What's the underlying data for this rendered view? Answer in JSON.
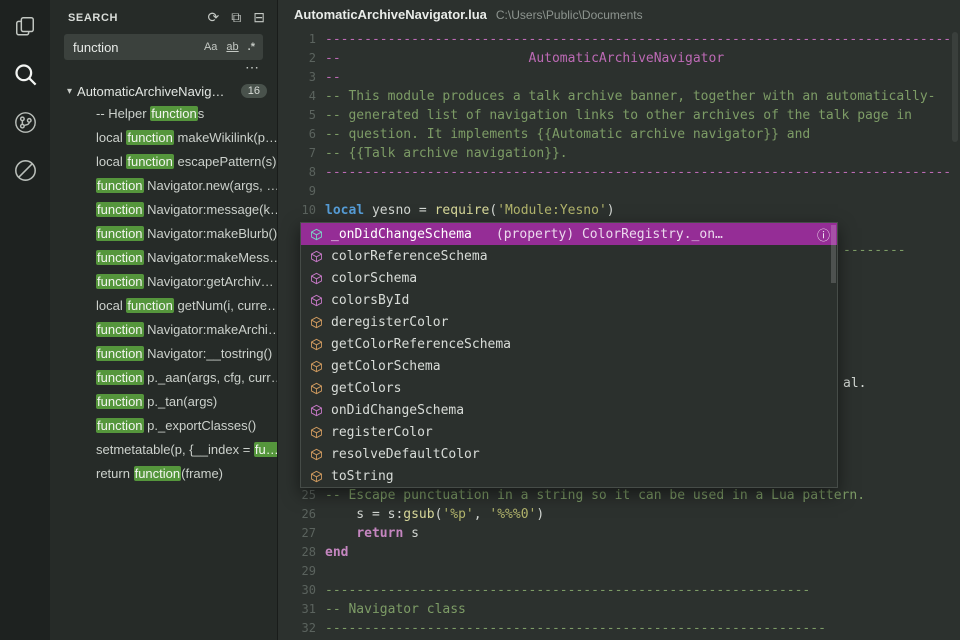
{
  "colors": {
    "match_green": "#55963c",
    "suggest_selected": "#952d96",
    "comment_green": "#7d9c66",
    "comment_pink": "#bd6ab5"
  },
  "activity_bar": {
    "items": [
      "files-icon",
      "search-icon",
      "source-control-icon",
      "blocked-icon"
    ]
  },
  "search_panel": {
    "title": "SEARCH",
    "actions": {
      "refresh": "⟳",
      "open_in_editor": "⧉",
      "collapse": "⊟"
    },
    "query": "function",
    "options": {
      "match_case": "Aa",
      "whole_word": "ab",
      "regex": ".*"
    },
    "more": "⋯",
    "file": {
      "twisty": "▾",
      "label": "AutomaticArchiveNavig…",
      "badge": "16"
    },
    "results": [
      {
        "pre": "-- Helper ",
        "match": "function",
        "post": "s"
      },
      {
        "pre": "local ",
        "match": "function",
        "post": " makeWikilink(p…"
      },
      {
        "pre": "local ",
        "match": "function",
        "post": " escapePattern(s)"
      },
      {
        "pre": "",
        "match": "function",
        "post": " Navigator.new(args, …"
      },
      {
        "pre": "",
        "match": "function",
        "post": " Navigator:message(k…"
      },
      {
        "pre": "",
        "match": "function",
        "post": " Navigator:makeBlurb()"
      },
      {
        "pre": "",
        "match": "function",
        "post": " Navigator:makeMess…"
      },
      {
        "pre": "",
        "match": "function",
        "post": " Navigator:getArchiv…"
      },
      {
        "pre": "local ",
        "match": "function",
        "post": " getNum(i, curre…"
      },
      {
        "pre": "",
        "match": "function",
        "post": " Navigator:makeArchi…"
      },
      {
        "pre": "",
        "match": "function",
        "post": " Navigator:__tostring()"
      },
      {
        "pre": "",
        "match": "function",
        "post": " p._aan(args, cfg, curr…"
      },
      {
        "pre": "",
        "match": "function",
        "post": " p._tan(args)"
      },
      {
        "pre": "",
        "match": "function",
        "post": " p._exportClasses()"
      },
      {
        "pre": "setmetatable(p, {__index = ",
        "match": "fu…",
        "post": ""
      },
      {
        "pre": "return ",
        "match": "function",
        "post": "(frame)"
      }
    ]
  },
  "editor": {
    "file_name": "AutomaticArchiveNavigator.lua",
    "file_path": "C:\\Users\\Public\\Documents",
    "fragments": {
      "line12": "--------",
      "line19": "al."
    },
    "lines": [
      {
        "n": 1,
        "s": [
          [
            "--------------------------------------------------------------------------------",
            "c-pink"
          ]
        ]
      },
      {
        "n": 2,
        "s": [
          [
            "--                        AutomaticArchiveNavigator",
            "c-pink"
          ]
        ]
      },
      {
        "n": 3,
        "s": [
          [
            "--",
            "c-pink"
          ]
        ]
      },
      {
        "n": 4,
        "s": [
          [
            "-- This module produces a talk archive banner, together with an automatically-",
            "c-com"
          ]
        ]
      },
      {
        "n": 5,
        "s": [
          [
            "-- generated list of navigation links to other archives of the talk page in",
            "c-com"
          ]
        ]
      },
      {
        "n": 6,
        "s": [
          [
            "-- question. It implements {{Automatic archive navigator}} and",
            "c-com"
          ]
        ]
      },
      {
        "n": 7,
        "s": [
          [
            "-- {{Talk archive navigation}}.",
            "c-com"
          ]
        ]
      },
      {
        "n": 8,
        "s": [
          [
            "--------------------------------------------------------------------------------",
            "c-pink"
          ]
        ]
      },
      {
        "n": 9,
        "s": []
      },
      {
        "n": 10,
        "s": [
          [
            "local",
            "c-kw"
          ],
          [
            " yesno = ",
            "c-pl"
          ],
          [
            "require",
            "c-fn"
          ],
          [
            "(",
            "c-pl"
          ],
          [
            "'Module:Yesno'",
            "c-str"
          ],
          [
            ")",
            "c-pl"
          ]
        ]
      },
      {
        "n": 11,
        "s": []
      },
      {
        "n": 12,
        "s": []
      },
      {
        "n": 13,
        "s": []
      },
      {
        "n": 14,
        "s": []
      },
      {
        "n": 15,
        "s": []
      },
      {
        "n": 16,
        "s": []
      },
      {
        "n": 17,
        "s": []
      },
      {
        "n": 18,
        "s": []
      },
      {
        "n": 19,
        "s": []
      },
      {
        "n": 20,
        "s": []
      },
      {
        "n": 21,
        "s": []
      },
      {
        "n": 22,
        "s": []
      },
      {
        "n": 23,
        "s": []
      },
      {
        "n": 24,
        "s": []
      },
      {
        "n": 25,
        "s": [
          [
            "-- Escape punctuation in a string so it can be used in a Lua pattern.",
            "c-com"
          ]
        ]
      },
      {
        "n": 26,
        "s": [
          [
            "    s = s:",
            "c-pl"
          ],
          [
            "gsub",
            "c-fn"
          ],
          [
            "(",
            "c-pl"
          ],
          [
            "'%p'",
            "c-str"
          ],
          [
            ", ",
            "c-pl"
          ],
          [
            "'%%%0'",
            "c-str"
          ],
          [
            ")",
            "c-pl"
          ]
        ]
      },
      {
        "n": 27,
        "s": [
          [
            "    ",
            "c-pl"
          ],
          [
            "return",
            "c-kw2"
          ],
          [
            " s",
            "c-pl"
          ]
        ]
      },
      {
        "n": 28,
        "s": [
          [
            "end",
            "c-kw2"
          ]
        ]
      },
      {
        "n": 29,
        "s": []
      },
      {
        "n": 30,
        "s": [
          [
            "--------------------------------------------------------------",
            "c-com"
          ]
        ]
      },
      {
        "n": 31,
        "s": [
          [
            "-- Navigator class",
            "c-com"
          ]
        ]
      },
      {
        "n": 32,
        "s": [
          [
            "----------------------------------------------------------------",
            "c-com"
          ]
        ]
      }
    ]
  },
  "suggest": {
    "info_icon": "ⓘ",
    "icon_colors": {
      "property": "#c678c6",
      "method": "#cf9a5f",
      "selected": "#7cd0c4"
    },
    "items": [
      {
        "label": "_onDidChangeSchema",
        "detail": "(property) ColorRegistry._on…",
        "kind": "property",
        "selected": true
      },
      {
        "label": "colorReferenceSchema",
        "kind": "property"
      },
      {
        "label": "colorSchema",
        "kind": "property"
      },
      {
        "label": "colorsById",
        "kind": "property"
      },
      {
        "label": "deregisterColor",
        "kind": "method"
      },
      {
        "label": "getColorReferenceSchema",
        "kind": "method"
      },
      {
        "label": "getColorSchema",
        "kind": "method"
      },
      {
        "label": "getColors",
        "kind": "method"
      },
      {
        "label": "onDidChangeSchema",
        "kind": "property"
      },
      {
        "label": "registerColor",
        "kind": "method"
      },
      {
        "label": "resolveDefaultColor",
        "kind": "method"
      },
      {
        "label": "toString",
        "kind": "method"
      }
    ]
  }
}
